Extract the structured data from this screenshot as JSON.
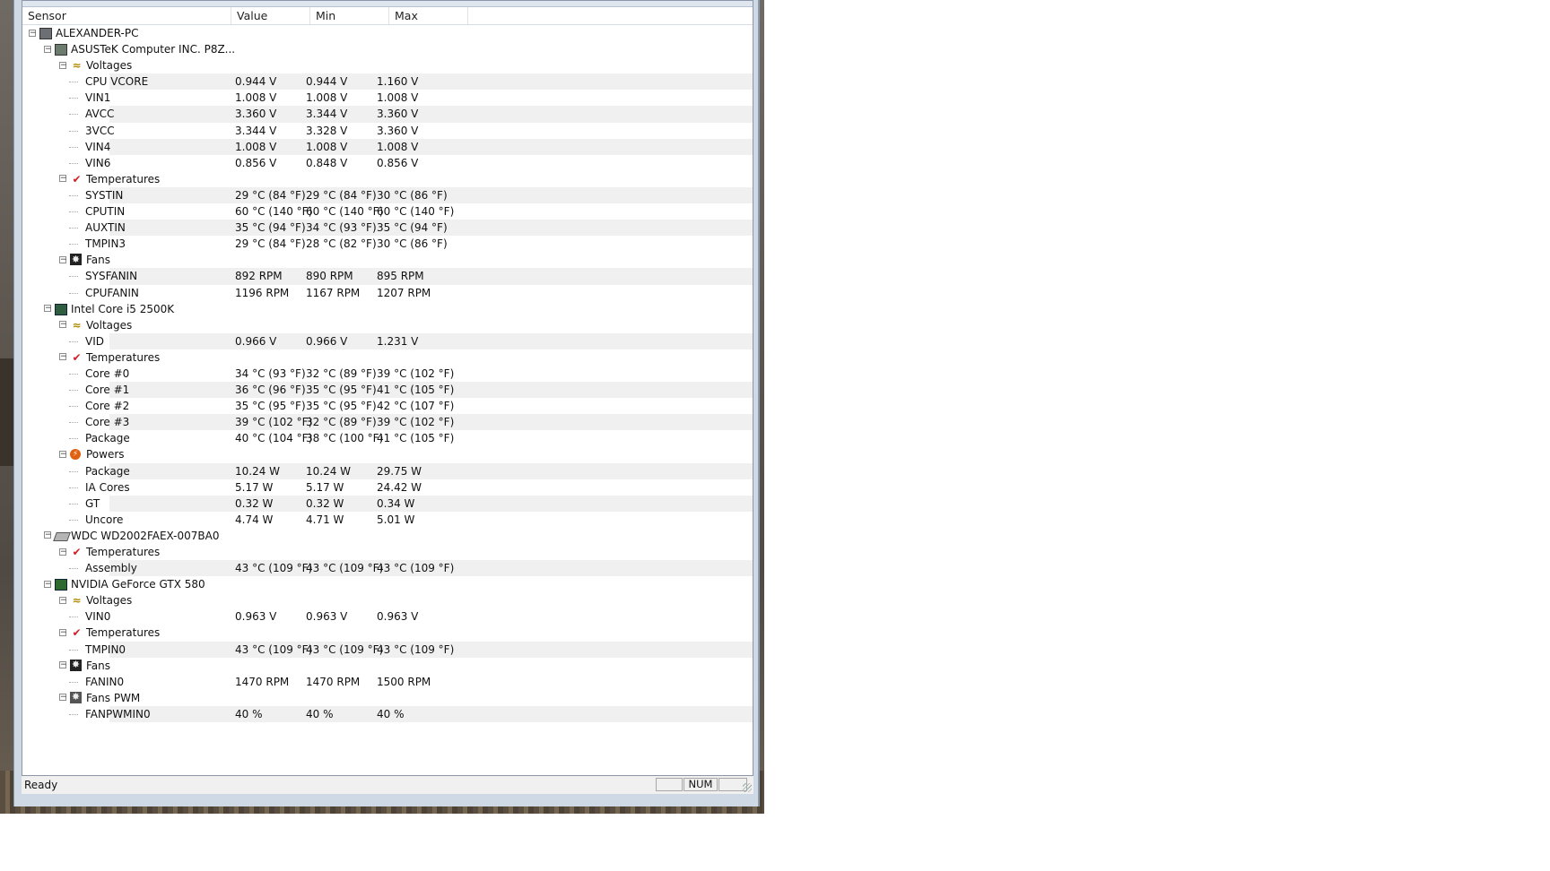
{
  "columns": [
    "Sensor",
    "Value",
    "Min",
    "Max"
  ],
  "status": {
    "text": "Ready",
    "num": "NUM"
  },
  "tree": [
    {
      "level": 0,
      "kind": "pc",
      "name": "ALEXANDER-PC"
    },
    {
      "level": 1,
      "kind": "mb",
      "name": "ASUSTeK Computer INC. P8Z..."
    },
    {
      "level": 2,
      "kind": "volt",
      "name": "Voltages"
    },
    {
      "level": 3,
      "kind": "leaf",
      "name": "CPU VCORE",
      "value": "0.944 V",
      "min": "0.944 V",
      "max": "1.160 V"
    },
    {
      "level": 3,
      "kind": "leaf",
      "name": "VIN1",
      "value": "1.008 V",
      "min": "1.008 V",
      "max": "1.008 V"
    },
    {
      "level": 3,
      "kind": "leaf",
      "name": "AVCC",
      "value": "3.360 V",
      "min": "3.344 V",
      "max": "3.360 V"
    },
    {
      "level": 3,
      "kind": "leaf",
      "name": "3VCC",
      "value": "3.344 V",
      "min": "3.328 V",
      "max": "3.360 V"
    },
    {
      "level": 3,
      "kind": "leaf",
      "name": "VIN4",
      "value": "1.008 V",
      "min": "1.008 V",
      "max": "1.008 V"
    },
    {
      "level": 3,
      "kind": "leaf",
      "name": "VIN6",
      "value": "0.856 V",
      "min": "0.848 V",
      "max": "0.856 V"
    },
    {
      "level": 2,
      "kind": "temp",
      "name": "Temperatures"
    },
    {
      "level": 3,
      "kind": "leaf",
      "name": "SYSTIN",
      "value": "29 °C  (84 °F)",
      "min": "29 °C  (84 °F)",
      "max": "30 °C  (86 °F)"
    },
    {
      "level": 3,
      "kind": "leaf",
      "name": "CPUTIN",
      "value": "60 °C  (140 °F)",
      "min": "60 °C  (140 °F)",
      "max": "60 °C  (140 °F)"
    },
    {
      "level": 3,
      "kind": "leaf",
      "name": "AUXTIN",
      "value": "35 °C  (94 °F)",
      "min": "34 °C  (93 °F)",
      "max": "35 °C  (94 °F)"
    },
    {
      "level": 3,
      "kind": "leaf",
      "name": "TMPIN3",
      "value": "29 °C  (84 °F)",
      "min": "28 °C  (82 °F)",
      "max": "30 °C  (86 °F)"
    },
    {
      "level": 2,
      "kind": "fan",
      "name": "Fans"
    },
    {
      "level": 3,
      "kind": "leaf",
      "name": "SYSFANIN",
      "value": "892 RPM",
      "min": "890 RPM",
      "max": "895 RPM"
    },
    {
      "level": 3,
      "kind": "leaf",
      "name": "CPUFANIN",
      "value": "1196 RPM",
      "min": "1167 RPM",
      "max": "1207 RPM"
    },
    {
      "level": 1,
      "kind": "cpu",
      "name": "Intel Core i5 2500K"
    },
    {
      "level": 2,
      "kind": "volt",
      "name": "Voltages"
    },
    {
      "level": 3,
      "kind": "leaf",
      "name": "VID",
      "value": "0.966 V",
      "min": "0.966 V",
      "max": "1.231 V"
    },
    {
      "level": 2,
      "kind": "temp",
      "name": "Temperatures"
    },
    {
      "level": 3,
      "kind": "leaf",
      "name": "Core #0",
      "value": "34 °C  (93 °F)",
      "min": "32 °C  (89 °F)",
      "max": "39 °C  (102 °F)"
    },
    {
      "level": 3,
      "kind": "leaf",
      "name": "Core #1",
      "value": "36 °C  (96 °F)",
      "min": "35 °C  (95 °F)",
      "max": "41 °C  (105 °F)"
    },
    {
      "level": 3,
      "kind": "leaf",
      "name": "Core #2",
      "value": "35 °C  (95 °F)",
      "min": "35 °C  (95 °F)",
      "max": "42 °C  (107 °F)"
    },
    {
      "level": 3,
      "kind": "leaf",
      "name": "Core #3",
      "value": "39 °C  (102 °F)",
      "min": "32 °C  (89 °F)",
      "max": "39 °C  (102 °F)"
    },
    {
      "level": 3,
      "kind": "leaf",
      "name": "Package",
      "value": "40 °C  (104 °F)",
      "min": "38 °C  (100 °F)",
      "max": "41 °C  (105 °F)"
    },
    {
      "level": 2,
      "kind": "pwr",
      "name": "Powers"
    },
    {
      "level": 3,
      "kind": "leaf",
      "name": "Package",
      "value": "10.24 W",
      "min": "10.24 W",
      "max": "29.75 W"
    },
    {
      "level": 3,
      "kind": "leaf",
      "name": "IA Cores",
      "value": "5.17 W",
      "min": "5.17 W",
      "max": "24.42 W"
    },
    {
      "level": 3,
      "kind": "leaf",
      "name": "GT",
      "value": "0.32 W",
      "min": "0.32 W",
      "max": "0.34 W"
    },
    {
      "level": 3,
      "kind": "leaf",
      "name": "Uncore",
      "value": "4.74 W",
      "min": "4.71 W",
      "max": "5.01 W"
    },
    {
      "level": 1,
      "kind": "hdd",
      "name": "WDC WD2002FAEX-007BA0"
    },
    {
      "level": 2,
      "kind": "temp",
      "name": "Temperatures"
    },
    {
      "level": 3,
      "kind": "leaf",
      "name": "Assembly",
      "value": "43 °C  (109 °F)",
      "min": "43 °C  (109 °F)",
      "max": "43 °C  (109 °F)"
    },
    {
      "level": 1,
      "kind": "gpu",
      "name": "NVIDIA GeForce GTX 580"
    },
    {
      "level": 2,
      "kind": "volt",
      "name": "Voltages"
    },
    {
      "level": 3,
      "kind": "leaf",
      "name": "VIN0",
      "value": "0.963 V",
      "min": "0.963 V",
      "max": "0.963 V"
    },
    {
      "level": 2,
      "kind": "temp",
      "name": "Temperatures"
    },
    {
      "level": 3,
      "kind": "leaf",
      "name": "TMPIN0",
      "value": "43 °C  (109 °F)",
      "min": "43 °C  (109 °F)",
      "max": "43 °C  (109 °F)"
    },
    {
      "level": 2,
      "kind": "fan",
      "name": "Fans"
    },
    {
      "level": 3,
      "kind": "leaf",
      "name": "FANIN0",
      "value": "1470 RPM",
      "min": "1470 RPM",
      "max": "1500 RPM"
    },
    {
      "level": 2,
      "kind": "pwm",
      "name": "Fans PWM"
    },
    {
      "level": 3,
      "kind": "leaf",
      "name": "FANPWMIN0",
      "value": "40 %",
      "min": "40 %",
      "max": "40 %"
    }
  ]
}
